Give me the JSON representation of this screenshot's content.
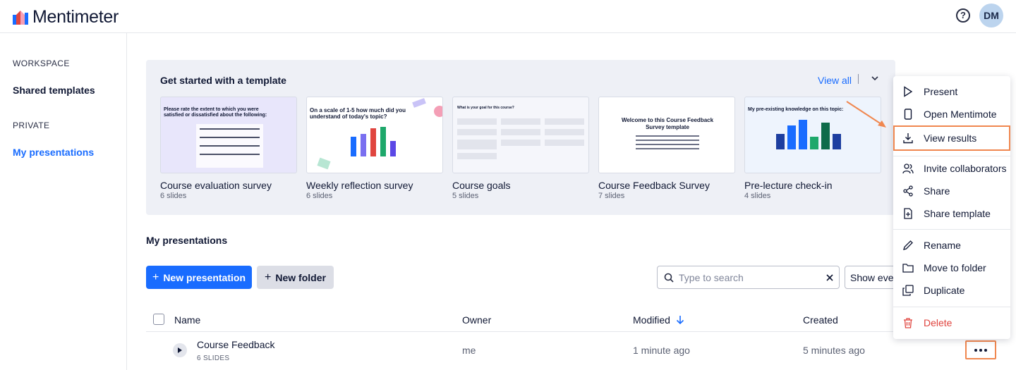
{
  "app": {
    "logo_text": "Mentimeter",
    "avatar_initials": "DM"
  },
  "sidebar": {
    "workspace_heading": "WORKSPACE",
    "shared_templates": "Shared templates",
    "private_heading": "PRIVATE",
    "my_presentations": "My presentations"
  },
  "templates": {
    "title": "Get started with a template",
    "view_all": "View all",
    "cards": [
      {
        "title": "Course evaluation survey",
        "slides": "6 slides",
        "thumb_text": "Please rate the extent to which you were satisfied or dissatisfied about the following:"
      },
      {
        "title": "Weekly reflection survey",
        "slides": "6 slides",
        "thumb_text": "On a scale of 1-5 how much did you understand of today's topic?"
      },
      {
        "title": "Course goals",
        "slides": "5 slides",
        "thumb_text": "What is your goal for this course?"
      },
      {
        "title": "Course Feedback Survey",
        "slides": "7 slides",
        "thumb_text": "Welcome to this Course Feedback Survey template"
      },
      {
        "title": "Pre-lecture check-in",
        "slides": "4 slides",
        "thumb_text": "My pre-existing knowledge on this topic:"
      }
    ]
  },
  "presentations": {
    "title": "My presentations",
    "new_presentation": "New presentation",
    "new_folder": "New folder",
    "search_placeholder": "Type to search",
    "show_filter": "Show ever",
    "columns": {
      "name": "Name",
      "owner": "Owner",
      "modified": "Modified",
      "created": "Created"
    },
    "rows": [
      {
        "name": "Course Feedback",
        "slides": "6 SLIDES",
        "owner": "me",
        "modified": "1 minute ago",
        "created": "5 minutes ago"
      }
    ]
  },
  "context_menu": {
    "items": [
      {
        "label": "Present",
        "icon": "play-icon"
      },
      {
        "label": "Open Mentimote",
        "icon": "phone-icon"
      },
      {
        "label": "View results",
        "icon": "download-icon"
      },
      {
        "label": "Invite collaborators",
        "icon": "users-icon"
      },
      {
        "label": "Share",
        "icon": "share-icon"
      },
      {
        "label": "Share template",
        "icon": "share-template-icon"
      },
      {
        "label": "Rename",
        "icon": "pencil-icon"
      },
      {
        "label": "Move to folder",
        "icon": "folder-icon"
      },
      {
        "label": "Duplicate",
        "icon": "duplicate-icon"
      },
      {
        "label": "Delete",
        "icon": "trash-icon"
      }
    ]
  },
  "colors": {
    "accent": "#196cff",
    "highlight": "#f0874f",
    "danger": "#e0453f",
    "panel": "#eef0f6"
  }
}
